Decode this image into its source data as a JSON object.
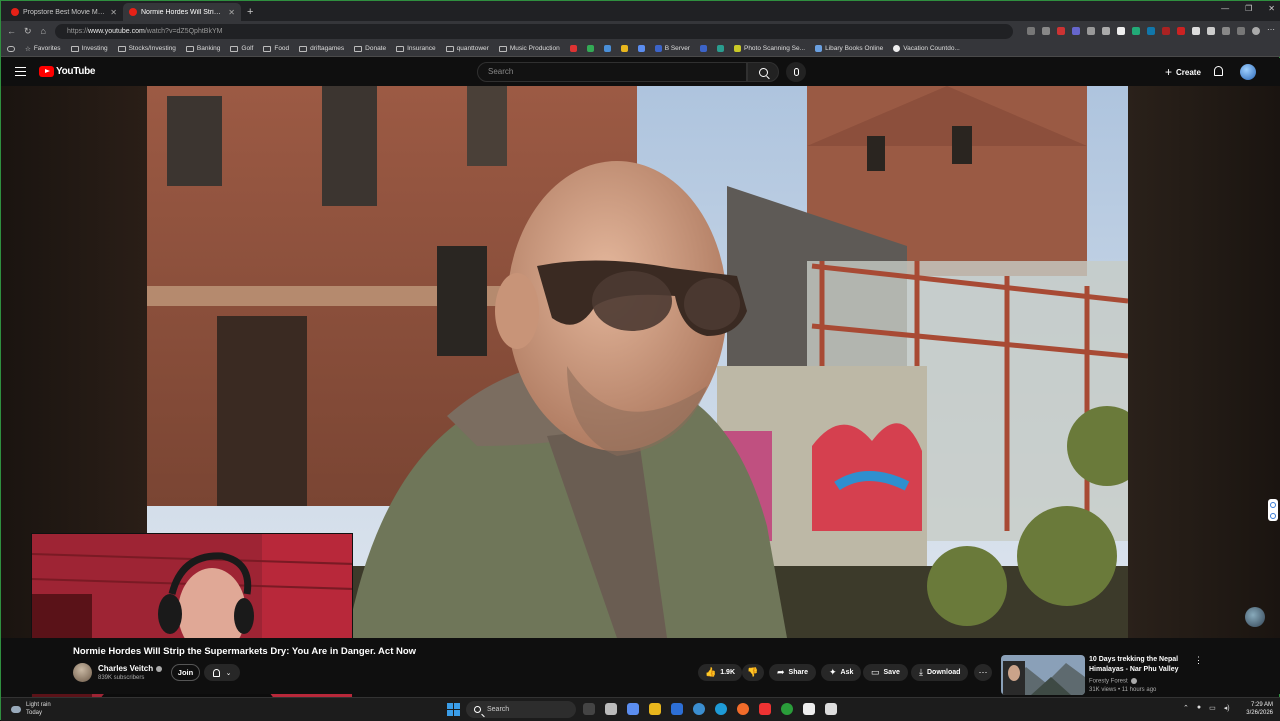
{
  "browser": {
    "tabs": [
      {
        "title": "Propstore Best Movie Memorabili...",
        "active": false
      },
      {
        "title": "Normie Hordes Will Strip the...",
        "active": true
      }
    ],
    "url_prefix": "https://",
    "url_host": "www.youtube.com",
    "url_path": "/watch?v=dZ5QphtBkYM",
    "bookmarks": [
      {
        "label": "Favorites",
        "icon": "star-icon"
      },
      {
        "label": "Investing",
        "icon": "folder-icon"
      },
      {
        "label": "Stocks/Investing",
        "icon": "folder-icon"
      },
      {
        "label": "Banking",
        "icon": "folder-icon"
      },
      {
        "label": "Golf",
        "icon": "folder-icon"
      },
      {
        "label": "Food",
        "icon": "folder-icon"
      },
      {
        "label": "driftagames",
        "icon": "folder-icon"
      },
      {
        "label": "Donate",
        "icon": "folder-icon"
      },
      {
        "label": "Insurance",
        "icon": "folder-icon"
      },
      {
        "label": "quanttower",
        "icon": "folder-icon"
      },
      {
        "label": "Music Production",
        "icon": "folder-icon"
      },
      {
        "label": "B Server",
        "icon": "site-icon"
      },
      {
        "label": "Photo Scanning Se...",
        "icon": "site-icon"
      },
      {
        "label": "Libary Books Online",
        "icon": "site-icon"
      },
      {
        "label": "Vacation Countdo...",
        "icon": "site-icon"
      }
    ]
  },
  "youtube": {
    "logo_text": "YouTube",
    "search_placeholder": "Search",
    "create_label": "Create",
    "brand_color": "#ff0000"
  },
  "video": {
    "title": "Normie Hordes Will Strip the Supermarkets Dry: You Are in Danger. Act Now",
    "channel_name": "Charles Veitch",
    "subscribers": "839K subscribers",
    "join_label": "Join",
    "likes": "1.9K",
    "share_label": "Share",
    "ask_label": "Ask",
    "save_label": "Save",
    "download_label": "Download"
  },
  "recommended": {
    "title": "10 Days trekking the Nepal Himalayas - Nar Phu Valley",
    "channel": "Foresty Forest",
    "meta": "31K views • 11 hours ago"
  },
  "taskbar": {
    "weather_title": "Light rain",
    "weather_sub": "Today",
    "search_label": "Search",
    "time": "7:29 AM",
    "date": "3/26/2026"
  }
}
